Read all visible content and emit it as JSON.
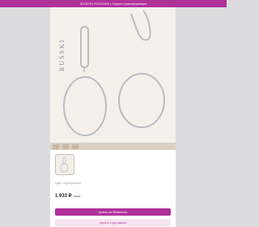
{
  "header": {
    "title": "ЗОЛОТО РУССКИХ | Серьги-трансформеры"
  },
  "hero": {
    "brand": "RUSSKI"
  },
  "product": {
    "meta": "Цвет: серебристый",
    "price": "1 933 ₽",
    "old_price": "2 662"
  },
  "actions": {
    "primary_label": "Купить на Wildberries",
    "secondary_label": "Купить с доставкой"
  },
  "colors": {
    "accent": "#b1319a",
    "hero_bg": "#f5f0ea",
    "metal": "#b9bcc1"
  }
}
